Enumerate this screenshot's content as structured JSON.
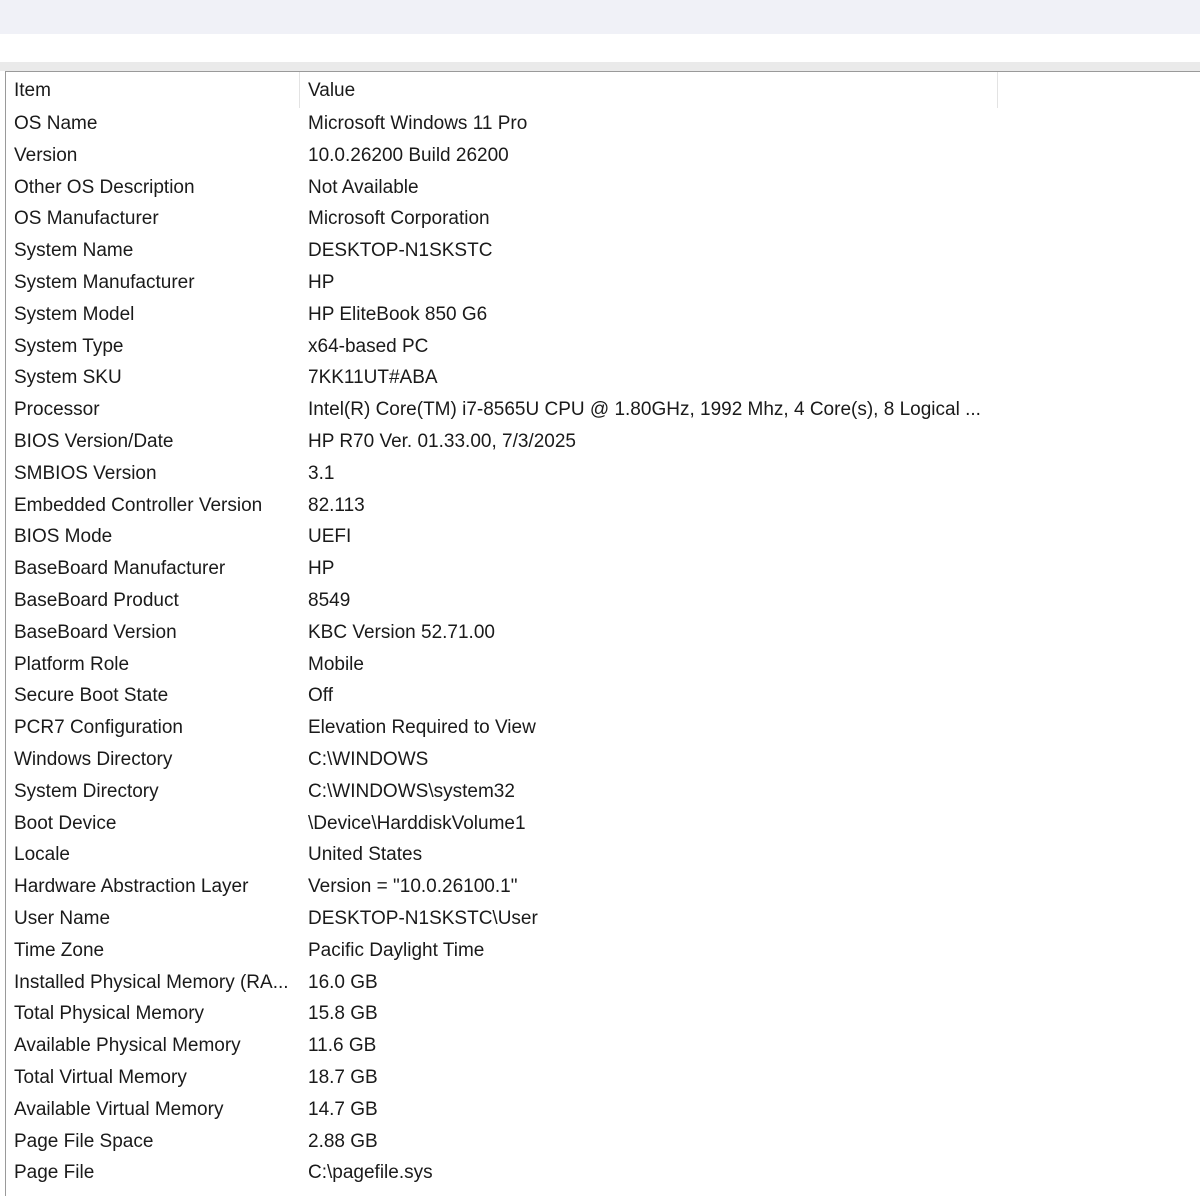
{
  "table": {
    "columns": [
      "Item",
      "Value"
    ],
    "rows": [
      {
        "item": "OS Name",
        "value": "Microsoft Windows 11 Pro"
      },
      {
        "item": "Version",
        "value": "10.0.26200 Build 26200"
      },
      {
        "item": "Other OS Description",
        "value": "Not Available"
      },
      {
        "item": "OS Manufacturer",
        "value": "Microsoft Corporation"
      },
      {
        "item": "System Name",
        "value": "DESKTOP-N1SKSTC"
      },
      {
        "item": "System Manufacturer",
        "value": "HP"
      },
      {
        "item": "System Model",
        "value": "HP EliteBook 850 G6"
      },
      {
        "item": "System Type",
        "value": "x64-based PC"
      },
      {
        "item": "System SKU",
        "value": "7KK11UT#ABA"
      },
      {
        "item": "Processor",
        "value": "Intel(R) Core(TM) i7-8565U CPU @ 1.80GHz, 1992 Mhz, 4 Core(s), 8 Logical ..."
      },
      {
        "item": "BIOS Version/Date",
        "value": "HP R70 Ver. 01.33.00, 7/3/2025"
      },
      {
        "item": "SMBIOS Version",
        "value": "3.1"
      },
      {
        "item": "Embedded Controller Version",
        "value": "82.113"
      },
      {
        "item": "BIOS Mode",
        "value": "UEFI"
      },
      {
        "item": "BaseBoard Manufacturer",
        "value": "HP"
      },
      {
        "item": "BaseBoard Product",
        "value": "8549"
      },
      {
        "item": "BaseBoard Version",
        "value": "KBC Version 52.71.00"
      },
      {
        "item": "Platform Role",
        "value": "Mobile"
      },
      {
        "item": "Secure Boot State",
        "value": "Off"
      },
      {
        "item": "PCR7 Configuration",
        "value": "Elevation Required to View"
      },
      {
        "item": "Windows Directory",
        "value": "C:\\WINDOWS"
      },
      {
        "item": "System Directory",
        "value": "C:\\WINDOWS\\system32"
      },
      {
        "item": "Boot Device",
        "value": "\\Device\\HarddiskVolume1"
      },
      {
        "item": "Locale",
        "value": "United States"
      },
      {
        "item": "Hardware Abstraction Layer",
        "value": "Version = \"10.0.26100.1\""
      },
      {
        "item": "User Name",
        "value": "DESKTOP-N1SKSTC\\User"
      },
      {
        "item": "Time Zone",
        "value": "Pacific Daylight Time"
      },
      {
        "item": "Installed Physical Memory (RA...",
        "value": "16.0 GB"
      },
      {
        "item": "Total Physical Memory",
        "value": "15.8 GB"
      },
      {
        "item": "Available Physical Memory",
        "value": "11.6 GB"
      },
      {
        "item": "Total Virtual Memory",
        "value": "18.7 GB"
      },
      {
        "item": "Available Virtual Memory",
        "value": "14.7 GB"
      },
      {
        "item": "Page File Space",
        "value": "2.88 GB"
      },
      {
        "item": "Page File",
        "value": "C:\\pagefile.sys"
      }
    ]
  }
}
